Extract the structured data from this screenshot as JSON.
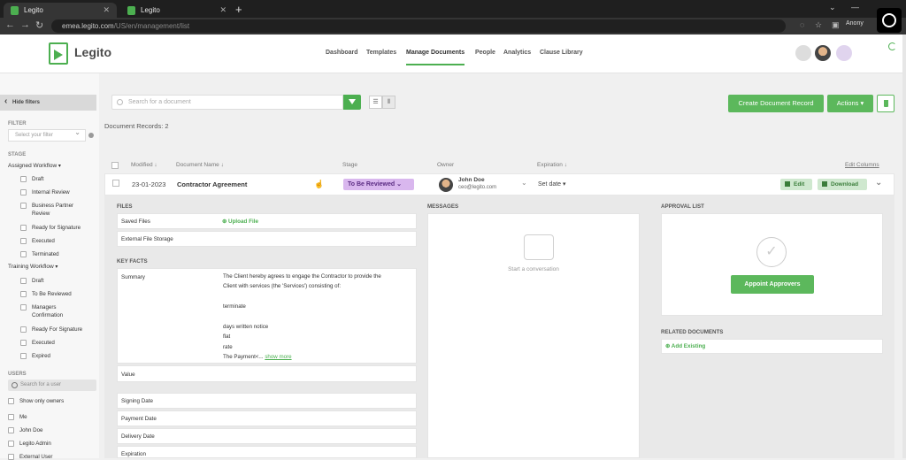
{
  "browser": {
    "tabs": [
      {
        "title": "Legito"
      },
      {
        "title": "Legito"
      }
    ],
    "url_host": "emea.legito.com",
    "url_path": "/US/en/management/list",
    "profile": "Anony"
  },
  "app": {
    "logo_text": "Legito",
    "nav": [
      "Dashboard",
      "Templates",
      "Manage Documents",
      "People",
      "Analytics",
      "Clause Library"
    ],
    "active_nav": "Manage Documents"
  },
  "sidebar": {
    "hide_filters": "Hide filters",
    "filter_heading": "FILTER",
    "filter_placeholder": "Select your filter",
    "stage_heading": "STAGE",
    "assigned_workflow": {
      "label": "Assigned Workflow",
      "items": [
        "Draft",
        "Internal Review",
        "Business Partner Review",
        "Ready for Signature",
        "Executed",
        "Terminated"
      ]
    },
    "training_workflow": {
      "label": "Training Workflow",
      "items": [
        "Draft",
        "To Be Reviewed",
        "Managers Confirmation",
        "Ready For Signature",
        "Executed",
        "Expired"
      ]
    },
    "users_heading": "USERS",
    "user_search_placeholder": "Search for a user",
    "show_only_owners": "Show only owners",
    "users": [
      "Me",
      "John Doe",
      "Legito Admin",
      "External User"
    ]
  },
  "toolbar": {
    "search_placeholder": "Search for a document",
    "create_label": "Create Document Record",
    "actions_label": "Actions ▾",
    "records_label": "Document Records: 2"
  },
  "table": {
    "headers": {
      "modified": "Modified",
      "name": "Document Name",
      "stage": "Stage",
      "owner": "Owner",
      "expiration": "Expiration"
    },
    "edit_columns": "Edit Columns",
    "row": {
      "modified": "23-01-2023",
      "name": "Contractor Agreement",
      "stage": "To Be Reviewed",
      "owner_name": "John Doe",
      "owner_email": "ceo@legito.com",
      "expiration": "Set date ▾",
      "edit_label": "Edit",
      "download_label": "Download"
    }
  },
  "detail": {
    "files_heading": "FILES",
    "saved_files": "Saved Files",
    "upload_file": "Upload File",
    "external_storage": "External File Storage",
    "key_facts_heading": "KEY FACTS",
    "summary_label": "Summary",
    "summary_lines": [
      "The Client hereby agrees to engage the Contractor to provide the",
      "Client with services (the 'Services') consisting of:",
      "",
      "terminate",
      "",
      "days written notice",
      "flat",
      "rate",
      "The Payment<..."
    ],
    "show_more": "show more",
    "value_label": "Value",
    "signing_date": "Signing Date",
    "payment_date": "Payment Date",
    "delivery_date": "Delivery Date",
    "expiration_label": "Expiration",
    "messages_heading": "MESSAGES",
    "start_conversation": "Start a conversation",
    "approval_heading": "APPROVAL LIST",
    "appoint_approvers": "Appoint Approvers",
    "related_heading": "RELATED DOCUMENTS",
    "add_existing": "Add Existing"
  }
}
